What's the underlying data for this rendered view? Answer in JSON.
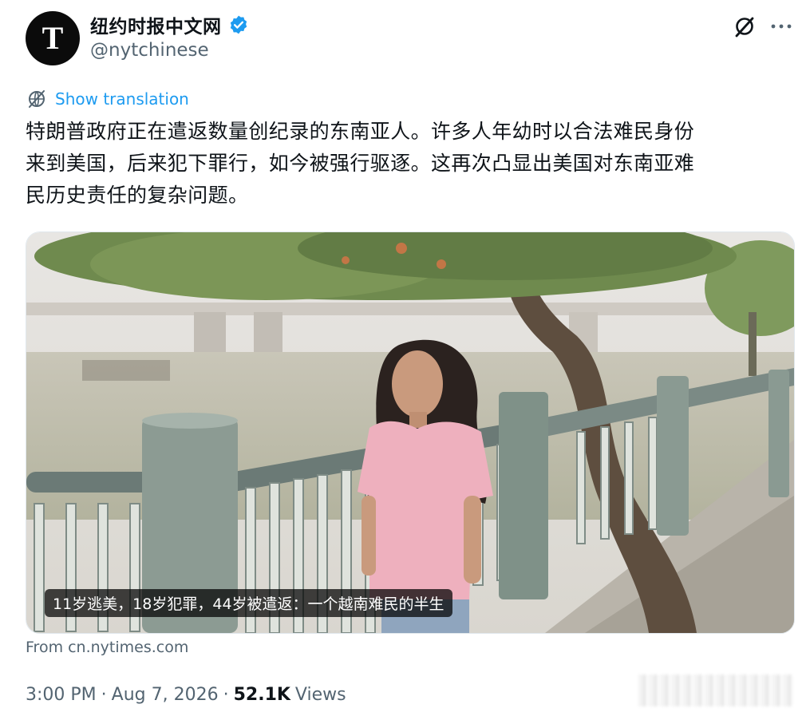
{
  "account": {
    "display_name": "纽约时报中文网",
    "handle": "@nytchinese",
    "verified": true,
    "avatar_letter": "T",
    "avatar_icon": "nyt-logo-icon",
    "verified_color": "#1d9bf0"
  },
  "header_actions": {
    "grok_icon": "grok-icon",
    "more_icon": "more-icon"
  },
  "translation": {
    "label": "Show translation",
    "icon": "globe-icon",
    "color": "#1d9bf0"
  },
  "tweet": {
    "lines": [
      "特朗普政府正在遣返数量创纪录的东南亚人。许多人年幼时以合法难民身份",
      "来到美国，后来犯下罪行，如今被强行驱逐。这再次凸显出美国对东南亚难",
      "民历史责任的复杂问题。"
    ]
  },
  "media": {
    "caption": "11岁逃美，18岁犯罪，44岁被遣返：一个越南难民的半生",
    "source": "From cn.nytimes.com"
  },
  "meta": {
    "time": "3:00 PM",
    "separator": "·",
    "date": "Aug 7, 2026",
    "views_count": "52.1K",
    "views_label": "Views"
  }
}
